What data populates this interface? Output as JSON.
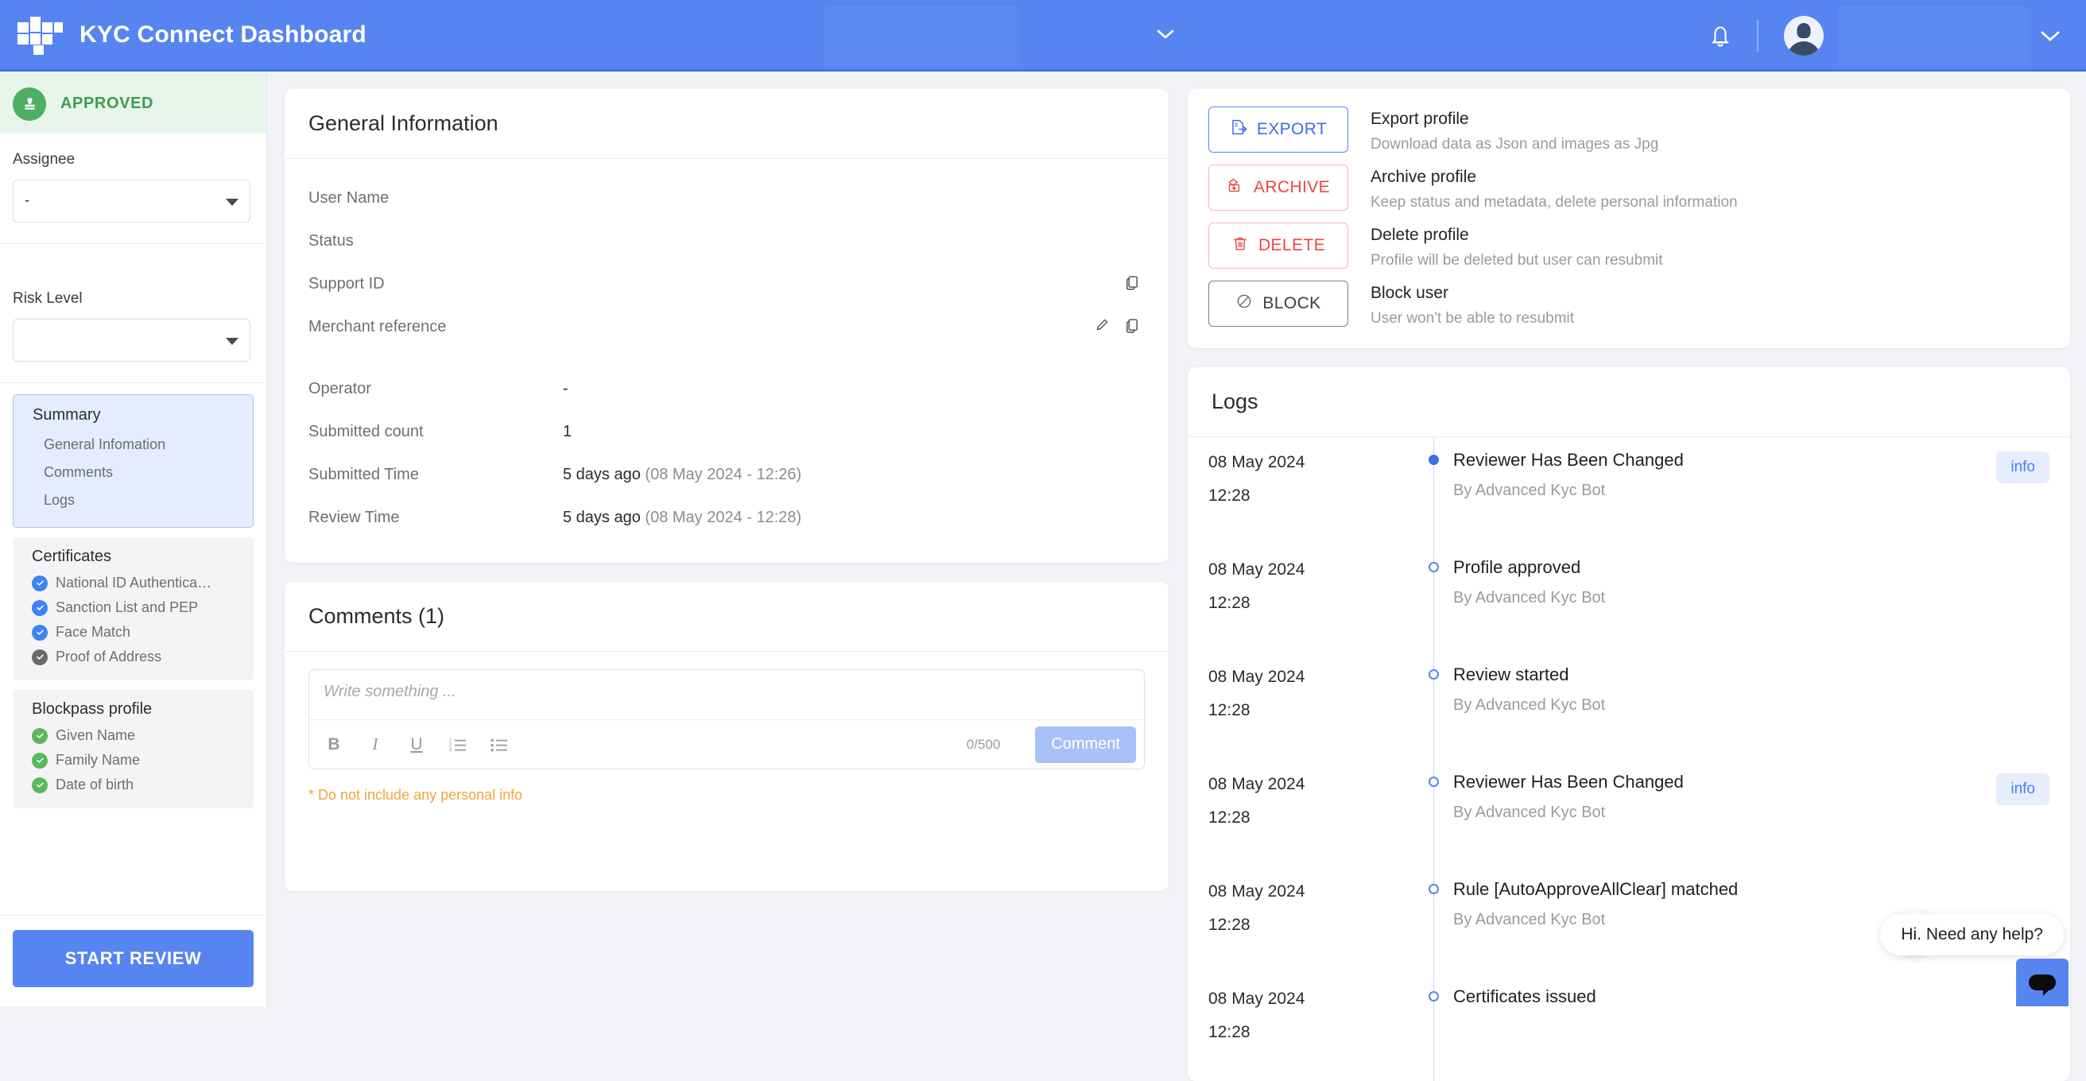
{
  "header": {
    "brand_title": "KYC Connect Dashboard",
    "logo_icon": "blockpass-logo-icon",
    "center_dropdown_icon": "chevron-down-icon",
    "bell_icon": "notification-bell-icon",
    "avatar_icon": "user-avatar-icon",
    "account_dropdown_icon": "chevron-down-icon"
  },
  "sidebar": {
    "status": {
      "label": "APPROVED",
      "icon": "stamp-icon",
      "color": "#4caf63"
    },
    "assignee": {
      "label": "Assignee",
      "value": "-",
      "placeholder": "-"
    },
    "risk_level": {
      "label": "Risk Level",
      "value": "",
      "placeholder": ""
    },
    "summary": {
      "title": "Summary",
      "links": [
        "General Infomation",
        "Comments",
        "Logs"
      ]
    },
    "certificates": {
      "title": "Certificates",
      "items": [
        {
          "label": "National ID Authentica…",
          "state": "blue"
        },
        {
          "label": "Sanction List and PEP",
          "state": "blue"
        },
        {
          "label": "Face Match",
          "state": "blue"
        },
        {
          "label": "Proof of Address",
          "state": "gray"
        }
      ]
    },
    "blockpass_profile": {
      "title": "Blockpass profile",
      "items": [
        {
          "label": "Given Name",
          "state": "green"
        },
        {
          "label": "Family Name",
          "state": "green"
        },
        {
          "label": "Date of birth",
          "state": "green"
        }
      ]
    },
    "start_review_label": "START REVIEW"
  },
  "general_info": {
    "title": "General Information",
    "rows": [
      {
        "label": "User Name",
        "value": "",
        "icons": []
      },
      {
        "label": "Status",
        "value": "",
        "icons": []
      },
      {
        "label": "Support ID",
        "value": "",
        "icons": [
          "copy-icon"
        ]
      },
      {
        "label": "Merchant reference",
        "value": "",
        "icons": [
          "edit-pencil-icon",
          "copy-icon"
        ]
      },
      {
        "label": "Operator",
        "value": "-",
        "icons": []
      },
      {
        "label": "Submitted count",
        "value": "1",
        "icons": []
      },
      {
        "label": "Submitted Time",
        "value": "5 days ago",
        "sub": "(08 May 2024 - 12:26)",
        "icons": []
      },
      {
        "label": "Review Time",
        "value": "5 days ago",
        "sub": "(08 May 2024 - 12:28)",
        "icons": []
      }
    ]
  },
  "comments": {
    "title": "Comments (1)",
    "editor_placeholder": "Write something ...",
    "editor_value": "",
    "char_count": "0/500",
    "submit_label": "Comment",
    "warning": "* Do not include any personal info",
    "format_buttons": [
      {
        "name": "bold-icon",
        "glyph": "B"
      },
      {
        "name": "italic-icon",
        "glyph": "I"
      },
      {
        "name": "underline-icon",
        "glyph": "U"
      },
      {
        "name": "ordered-list-icon",
        "glyph": ""
      },
      {
        "name": "bullet-list-icon",
        "glyph": ""
      }
    ]
  },
  "actions": [
    {
      "button_label": "EXPORT",
      "icon": "export-file-icon",
      "title": "Export profile",
      "desc": "Download data as Json and images as Jpg",
      "color": "#3e6fe3"
    },
    {
      "button_label": "ARCHIVE",
      "icon": "archive-box-icon",
      "title": "Archive profile",
      "desc": "Keep status and metadata, delete personal information",
      "color": "#ef4444"
    },
    {
      "button_label": "DELETE",
      "icon": "trash-icon",
      "title": "Delete profile",
      "desc": "Profile will be deleted but user can resubmit",
      "color": "#ef4444"
    },
    {
      "button_label": "BLOCK",
      "icon": "block-circle-slash-icon",
      "title": "Block user",
      "desc": "User won't be able to resubmit",
      "color": "#3c3c3c"
    }
  ],
  "logs": {
    "title": "Logs",
    "entries": [
      {
        "date": "08 May 2024",
        "time": "12:28",
        "title": "Reviewer Has Been Changed",
        "by": "By Advanced Kyc Bot",
        "badge": "info",
        "dot": "filled"
      },
      {
        "date": "08 May 2024",
        "time": "12:28",
        "title": "Profile approved",
        "by": "By Advanced Kyc Bot",
        "badge": "",
        "dot": "hollow"
      },
      {
        "date": "08 May 2024",
        "time": "12:28",
        "title": "Review started",
        "by": "By Advanced Kyc Bot",
        "badge": "",
        "dot": "hollow"
      },
      {
        "date": "08 May 2024",
        "time": "12:28",
        "title": "Reviewer Has Been Changed",
        "by": "By Advanced Kyc Bot",
        "badge": "info",
        "dot": "hollow"
      },
      {
        "date": "08 May 2024",
        "time": "12:28",
        "title": "Rule [AutoApproveAllClear] matched",
        "by": "By Advanced Kyc Bot",
        "badge": "",
        "dot": "hollow"
      },
      {
        "date": "08 May 2024",
        "time": "12:28",
        "title": "Certificates issued",
        "by": "",
        "badge": "",
        "dot": "hollow"
      }
    ]
  },
  "chat": {
    "close_icon": "close-x-icon",
    "message": "Hi. Need any help?",
    "launcher_icon": "chat-bubble-icon"
  }
}
